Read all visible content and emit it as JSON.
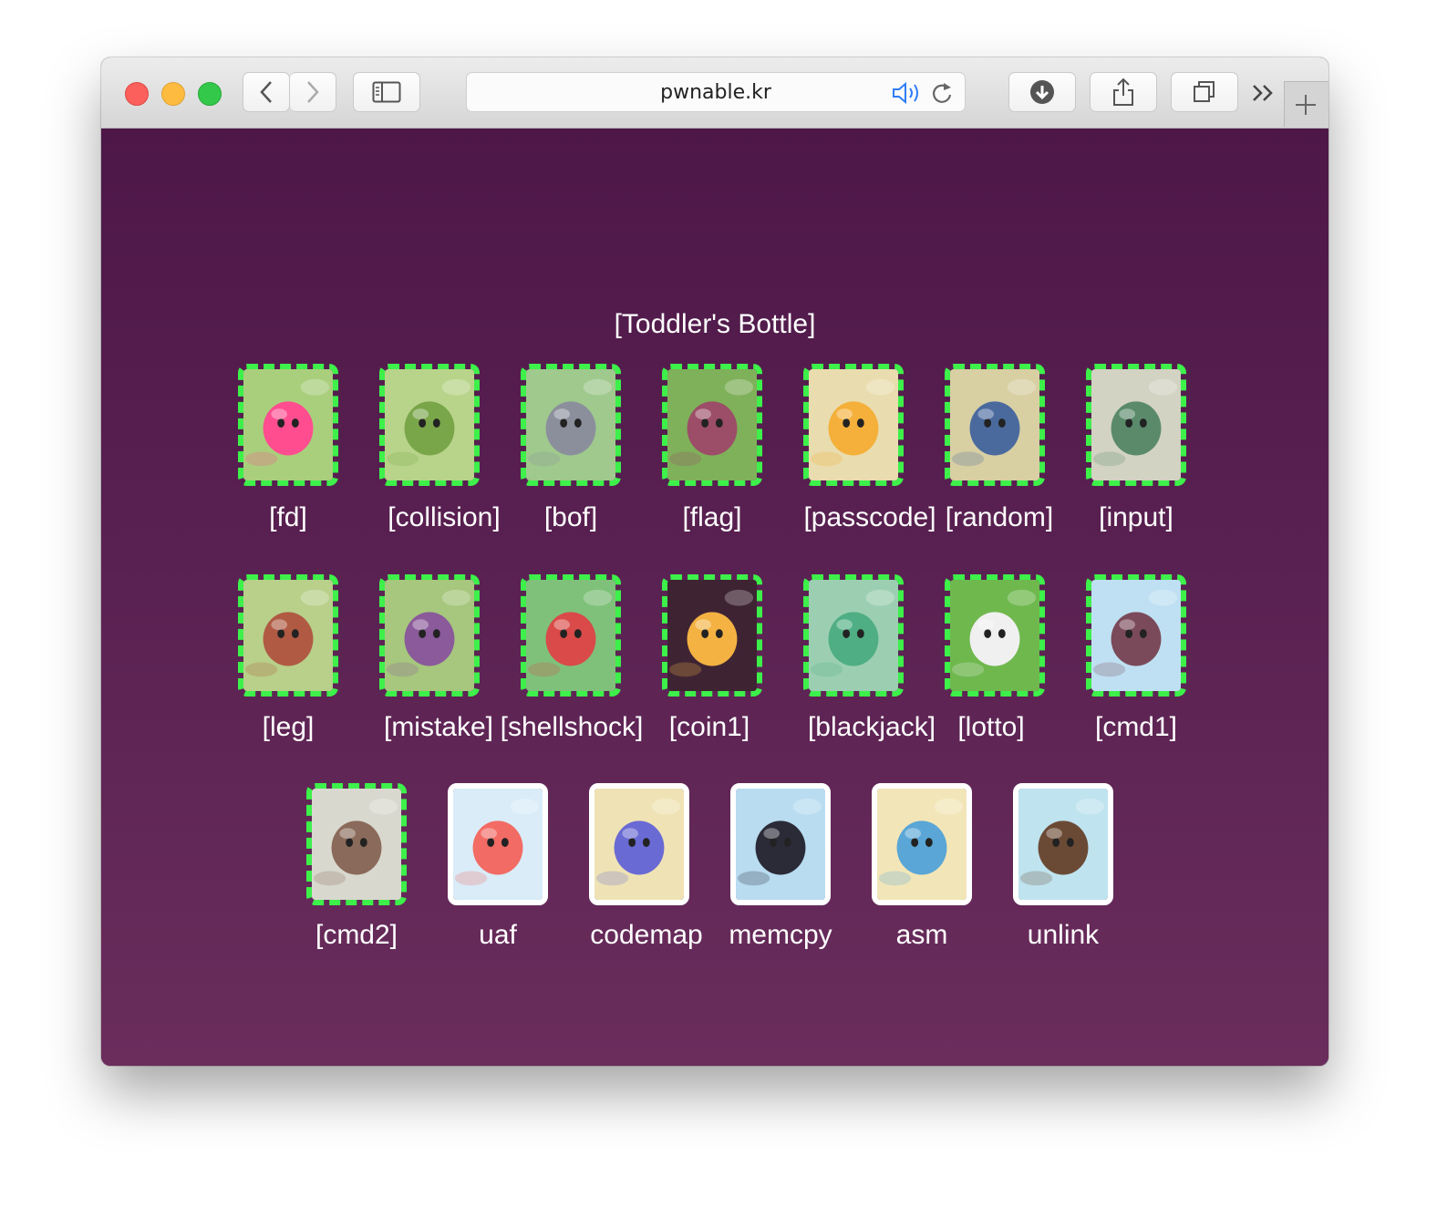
{
  "browser": {
    "url": "pwnable.kr"
  },
  "section": {
    "title": "[Toddler's Bottle]"
  },
  "challenges": [
    {
      "label": "[fd]",
      "solved": true,
      "scene": "pink-slime",
      "colors": [
        "#a9cf7d",
        "#ff4d8f"
      ]
    },
    {
      "label": "[collision]",
      "solved": true,
      "scene": "caterpillars",
      "colors": [
        "#b8d48a",
        "#7aa64a"
      ]
    },
    {
      "label": "[bof]",
      "solved": true,
      "scene": "raccoon",
      "colors": [
        "#9fc98d",
        "#8b8f9c"
      ]
    },
    {
      "label": "[flag]",
      "solved": true,
      "scene": "cocoon",
      "colors": [
        "#7fb05a",
        "#9c4d67"
      ]
    },
    {
      "label": "[passcode]",
      "solved": true,
      "scene": "yellow-bird",
      "colors": [
        "#e9dcae",
        "#f4b03a"
      ]
    },
    {
      "label": "[random]",
      "solved": true,
      "scene": "wolf",
      "colors": [
        "#d8cfa3",
        "#4a6a9e"
      ]
    },
    {
      "label": "[input]",
      "solved": true,
      "scene": "boxing-bug",
      "colors": [
        "#d2d3c2",
        "#5a8a6a"
      ]
    },
    {
      "label": "[leg]",
      "solved": true,
      "scene": "bear",
      "colors": [
        "#b8d08a",
        "#b05a43"
      ]
    },
    {
      "label": "[mistake]",
      "solved": true,
      "scene": "monkey",
      "colors": [
        "#a6c77d",
        "#8a5a9a"
      ]
    },
    {
      "label": "[shellshock]",
      "solved": true,
      "scene": "plant-mouth",
      "colors": [
        "#7fc17a",
        "#d94a48"
      ]
    },
    {
      "label": "[coin1]",
      "solved": true,
      "scene": "halloween",
      "colors": [
        "#3e2433",
        "#f4b242"
      ]
    },
    {
      "label": "[blackjack]",
      "solved": true,
      "scene": "dragon",
      "colors": [
        "#9ccfb2",
        "#4fae83"
      ]
    },
    {
      "label": "[lotto]",
      "solved": true,
      "scene": "rabbit",
      "colors": [
        "#6fb84e",
        "#f0f0f0"
      ]
    },
    {
      "label": "[cmd1]",
      "solved": true,
      "scene": "girl-shell",
      "colors": [
        "#bfe0f2",
        "#7a4a5a"
      ]
    },
    {
      "label": "[cmd2]",
      "solved": true,
      "scene": "hermit-shell",
      "colors": [
        "#d8d8cf",
        "#8a6a5a"
      ]
    },
    {
      "label": "uaf",
      "solved": false,
      "scene": "clouds",
      "colors": [
        "#d9ecf8",
        "#f26b64"
      ]
    },
    {
      "label": "codemap",
      "solved": false,
      "scene": "beach-towel",
      "colors": [
        "#efe3b5",
        "#6a6ad4"
      ]
    },
    {
      "label": "memcpy",
      "solved": false,
      "scene": "cat-umbrella",
      "colors": [
        "#b9dcf0",
        "#2b2b38"
      ]
    },
    {
      "label": "asm",
      "solved": false,
      "scene": "penguin-beach",
      "colors": [
        "#f2e6b8",
        "#5aa6d6"
      ]
    },
    {
      "label": "unlink",
      "solved": false,
      "scene": "beetle",
      "colors": [
        "#bfe3ef",
        "#6b4a35"
      ]
    }
  ]
}
